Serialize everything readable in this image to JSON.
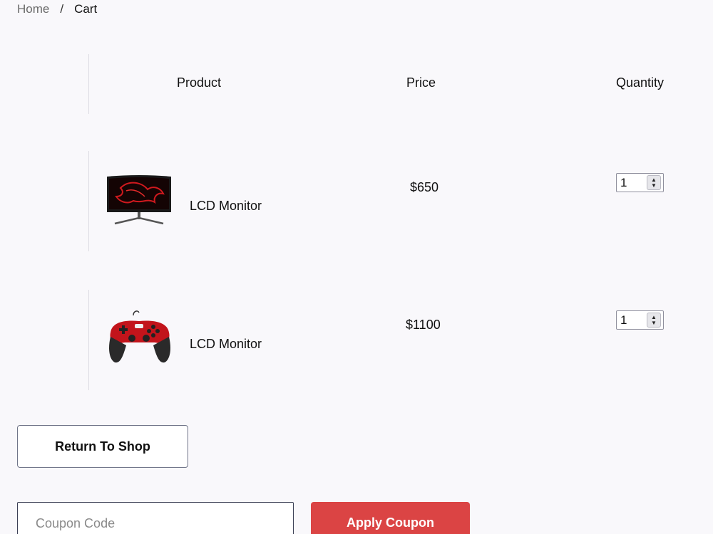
{
  "breadcrumb": {
    "home": "Home",
    "separator": "/",
    "current": "Cart"
  },
  "table": {
    "headers": {
      "product": "Product",
      "price": "Price",
      "quantity": "Quantity"
    },
    "items": [
      {
        "name": "LCD Monitor",
        "price": "$650",
        "quantity": "1",
        "image": "monitor-image"
      },
      {
        "name": "LCD Monitor",
        "price": "$1100",
        "quantity": "1",
        "image": "gamepad-image"
      }
    ]
  },
  "actions": {
    "return_label": "Return To Shop",
    "coupon_placeholder": "Coupon Code",
    "apply_label": "Apply Coupon"
  },
  "colors": {
    "accent": "#db4444",
    "background": "#f9f8fb"
  }
}
